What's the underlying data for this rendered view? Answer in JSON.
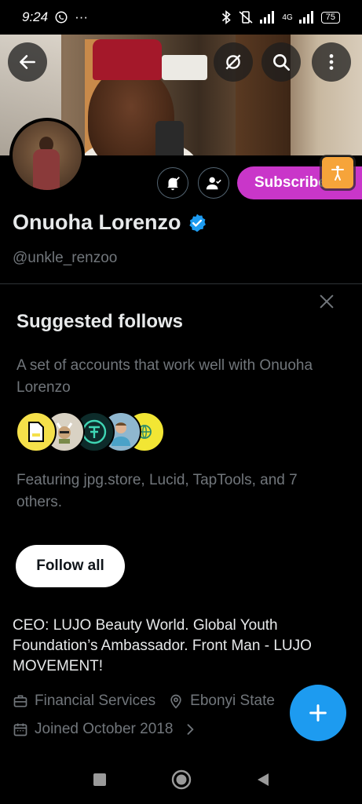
{
  "status_bar": {
    "time": "9:24",
    "more": "···",
    "network": "4G",
    "battery": "75"
  },
  "profile": {
    "display_name": "Onuoha Lorenzo",
    "handle": "@unkle_renzoo",
    "subscribe_label": "Subscribe",
    "bio": "CEO: LUJO Beauty World. Global Youth Foundation’s Ambassador. Front Man - LUJO MOVEMENT!",
    "category": "Financial Services",
    "location": "Ebonyi State",
    "joined": "Joined October 2018"
  },
  "suggested_follows": {
    "title": "Suggested follows",
    "description": "A set of accounts that work well with Onuoha Lorenzo",
    "featuring": "Featuring jpg.store, Lucid, TapTools, and 7 others.",
    "follow_all_label": "Follow all",
    "avatars": [
      {
        "name": "jpg.store",
        "color": "#f5e04a"
      },
      {
        "name": "Lucid",
        "color": "#d9d2c4"
      },
      {
        "name": "TapTools",
        "color": "#0d2b2a"
      },
      {
        "name": "person",
        "color": "#8fb7cf"
      },
      {
        "name": "other",
        "color": "#f2e634"
      }
    ]
  },
  "colors": {
    "accent": "#1d9bf0",
    "subscribe": "#c936c9",
    "muted": "#71767b"
  }
}
